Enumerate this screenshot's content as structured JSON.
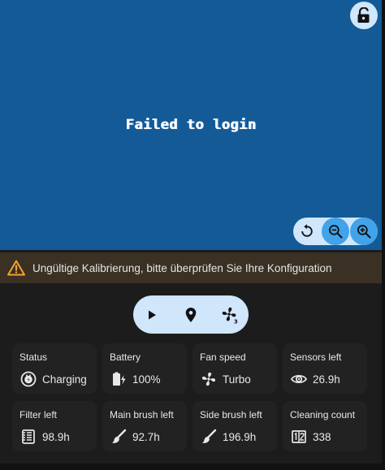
{
  "map": {
    "message": "Failed to login",
    "lock_icon": "lock-open-icon",
    "zoom_controls": [
      "reset-icon",
      "zoom-out-icon",
      "zoom-in-icon"
    ]
  },
  "warning": {
    "text": "Ungültige Kalibrierung, bitte überprüfen Sie Ihre Konfiguration",
    "color": "#f0a533"
  },
  "controls": [
    "play-icon",
    "location-pin-icon",
    "fan-speed-icon"
  ],
  "stats": [
    {
      "label": "Status",
      "value": "Charging",
      "icon": "charging-icon"
    },
    {
      "label": "Battery",
      "value": "100%",
      "icon": "battery-charging-icon"
    },
    {
      "label": "Fan speed",
      "value": "Turbo",
      "icon": "fan-icon"
    },
    {
      "label": "Sensors left",
      "value": "26.9h",
      "icon": "eye-icon"
    },
    {
      "label": "Filter left",
      "value": "98.9h",
      "icon": "filter-icon"
    },
    {
      "label": "Main brush left",
      "value": "92.7h",
      "icon": "brush-icon"
    },
    {
      "label": "Side brush left",
      "value": "196.9h",
      "icon": "brush-icon"
    },
    {
      "label": "Cleaning count",
      "value": "338",
      "icon": "counter-icon"
    }
  ],
  "colors": {
    "map_bg": "#135a97",
    "accent": "#41a3ea",
    "button_bg": "#cfe6fb",
    "card_bg": "#1c1c1c"
  }
}
